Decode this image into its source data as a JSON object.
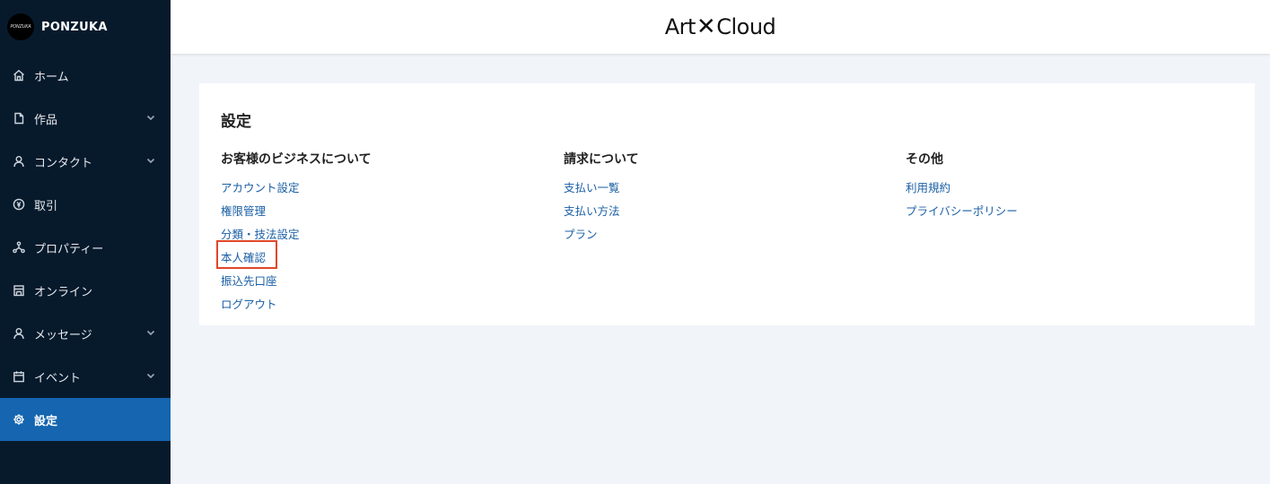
{
  "brand": {
    "name": "PONZUKA",
    "logo_text": "PONZUKA"
  },
  "sidebar": {
    "items": [
      {
        "label": "ホーム",
        "icon": "home-icon",
        "expandable": false
      },
      {
        "label": "作品",
        "icon": "document-icon",
        "expandable": true
      },
      {
        "label": "コンタクト",
        "icon": "person-icon",
        "expandable": true
      },
      {
        "label": "取引",
        "icon": "currency-icon",
        "expandable": false
      },
      {
        "label": "プロパティー",
        "icon": "network-icon",
        "expandable": false
      },
      {
        "label": "オンライン",
        "icon": "storefront-icon",
        "expandable": false
      },
      {
        "label": "メッセージ",
        "icon": "person-icon",
        "expandable": true
      },
      {
        "label": "イベント",
        "icon": "calendar-icon",
        "expandable": true
      },
      {
        "label": "設定",
        "icon": "gear-icon",
        "expandable": false,
        "active": true
      }
    ]
  },
  "header": {
    "logo_left": "Art",
    "logo_x": "✕",
    "logo_right": "Cloud"
  },
  "main": {
    "title": "設定",
    "columns": [
      {
        "heading": "お客様のビジネスについて",
        "links": [
          "アカウント設定",
          "権限管理",
          "分類・技法設定",
          "本人確認",
          "振込先口座",
          "ログアウト"
        ]
      },
      {
        "heading": "請求について",
        "links": [
          "支払い一覧",
          "支払い方法",
          "プラン"
        ]
      },
      {
        "heading": "その他",
        "links": [
          "利用規約",
          "プライバシーポリシー"
        ]
      }
    ]
  },
  "colors": {
    "sidebar_bg": "#071a2c",
    "active_bg": "#1565b0",
    "link": "#1a5fa5",
    "highlight": "#e0472a"
  }
}
